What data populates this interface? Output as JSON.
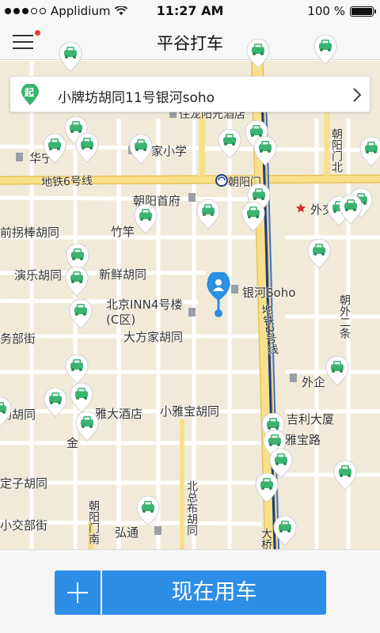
{
  "status_bar": {
    "carrier": "Applidium",
    "time": "11:27 AM",
    "battery": "100 %",
    "battery_level": 1.0
  },
  "navbar": {
    "title": "平谷打车",
    "has_notification": true
  },
  "pickup": {
    "badge": "起",
    "address": "小牌坊胡同11号银河soho"
  },
  "map_labels": {
    "huaqiao": "华宁",
    "zhongjia_school": "中家小学",
    "jiacheng_hotel": "住龙阳光酒店",
    "chaoyangmen": "朝阳门",
    "subway6": "地铁6号线",
    "chaoyang_office": "朝阳首府",
    "waijiaobu": "外交部",
    "qiangua": "前拐棒胡同",
    "zhugan": "竹竿",
    "yanle": "演乐胡同",
    "xinxian": "新鲜胡同",
    "yinhe_soho": "银河Soho",
    "beijing_inn": "北京INN4号楼",
    "c_zone": "(C区)",
    "dafangjia": "大方家胡同",
    "wubu": "务部街",
    "subway2": "地铁2号线",
    "chaowai2": "朝外二条",
    "waiqi": "外企",
    "jili": "吉利大厦",
    "yabao": "雅宝路",
    "yada_hotel": "雅大酒店",
    "xiaoyabao": "小雅宝胡同",
    "jin": "金",
    "hutong_left": "勖胡同",
    "lishi": "定子胡同",
    "xiaojiao": "小交部街",
    "beizongbu": "北总布胡同",
    "chaoyangmen_nan": "朝阳门南",
    "hongtong": "弘通",
    "chaoyangmen_bei": "朝阳门北",
    "daqiao": "大桥"
  },
  "actions": {
    "call_label": "现在用车"
  },
  "colors": {
    "accent": "#2d8ee6",
    "taxi_green": "#3cb371",
    "pin_green": "#3ab36e",
    "location_blue": "#2b8fe3",
    "map_bg": "#f1ead9",
    "major_road": "#f8e08b",
    "subway_line": "#1a3c82",
    "notification": "#e53935"
  },
  "icons": {
    "menu": "hamburger-menu-icon",
    "pickup_pin": "pickup-pin-icon",
    "chevron": "chevron-right-icon",
    "taxi": "taxi-marker-icon",
    "user_location": "user-location-icon",
    "plus": "plus-icon"
  }
}
